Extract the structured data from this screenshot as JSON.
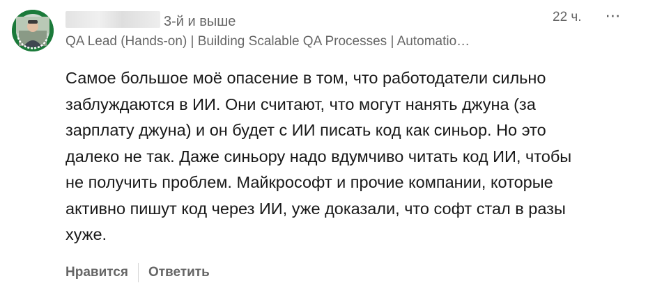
{
  "comment": {
    "author": {
      "name_hidden": true,
      "connection_degree": "3-й и выше",
      "headline": "QA Lead (Hands-on) | Building Scalable QA Processes | Automatio…"
    },
    "timestamp": "22 ч.",
    "more_icon": "⋯",
    "body_lines": [
      "Самое большое моё опасение в том, что работодатели сильно",
      "заблуждаются в ИИ. Они считают, что могут нанять джуна (за",
      "зарплату джуна) и он будет с ИИ писать код как синьор. Но это",
      "далеко не так. Даже синьору надо вдумчиво читать код ИИ, чтобы",
      "не получить проблем. Майкрософт и прочие компании, которые",
      "активно пишут код через ИИ, уже доказали, что софт стал в разы",
      "хуже."
    ],
    "actions": {
      "like_label": "Нравится",
      "reply_label": "Ответить"
    }
  },
  "colors": {
    "text_primary": "#191919",
    "text_secondary": "#666666",
    "divider": "#d6d6d6",
    "avatar_ring": "#1b7a3a"
  },
  "icons": {
    "avatar": "profile-photo",
    "more": "more-horizontal-icon"
  }
}
